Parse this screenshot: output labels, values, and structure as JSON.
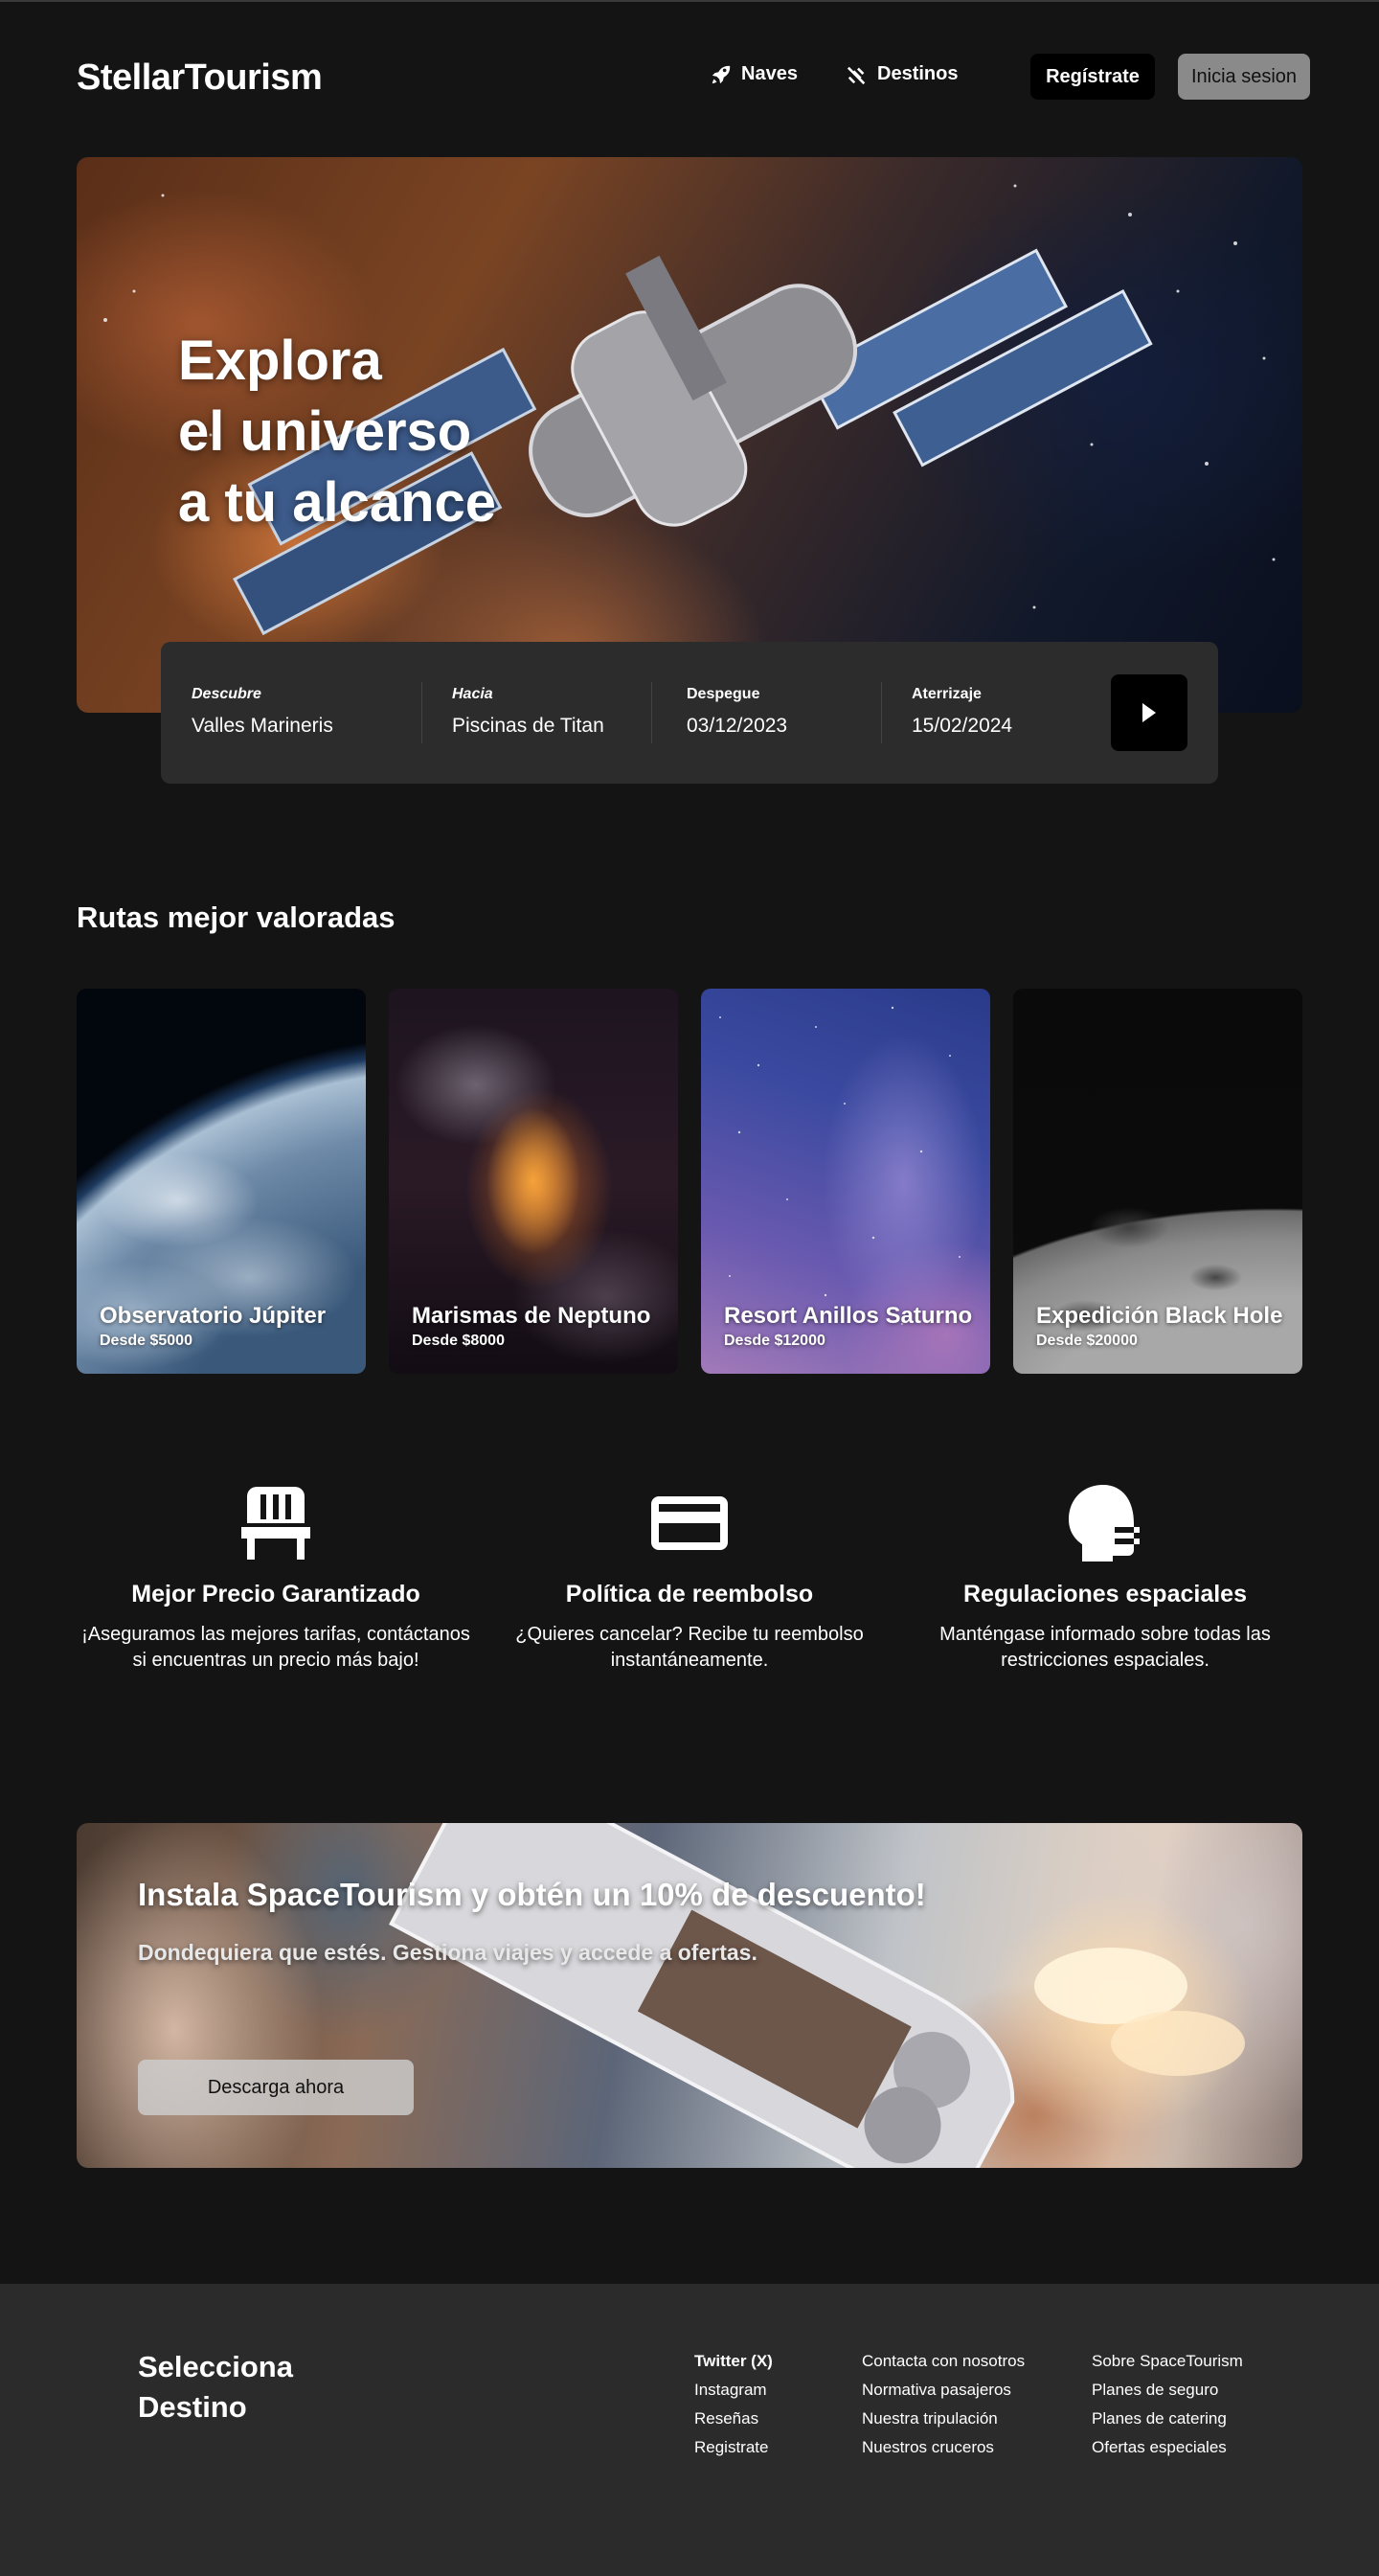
{
  "header": {
    "logo": "StellarTourism",
    "nav": {
      "naves": "Naves",
      "destinos": "Destinos"
    },
    "register_label": "Regístrate",
    "login_label": "Inicia sesion"
  },
  "hero": {
    "title_lines": [
      "Explora",
      "el universo",
      "a tu alcance"
    ]
  },
  "search": {
    "from": {
      "label": "Descubre",
      "value": "Valles Marineris"
    },
    "to": {
      "label": "Hacia",
      "value": "Piscinas de Titan"
    },
    "departure": {
      "label": "Despegue",
      "value": "03/12/2023"
    },
    "landing": {
      "label": "Aterrizaje",
      "value": "15/02/2024"
    }
  },
  "routes": {
    "title": "Rutas mejor valoradas",
    "cards": [
      {
        "name": "Observatorio Júpiter",
        "price": "Desde $5000"
      },
      {
        "name": "Marismas de Neptuno",
        "price": "Desde $8000"
      },
      {
        "name": "Resort Anillos Saturno",
        "price": "Desde $12000"
      },
      {
        "name": "Expedición Black Hole",
        "price": "Desde $20000"
      }
    ]
  },
  "features": [
    {
      "icon": "chair-icon",
      "title": "Mejor Precio Garantizado",
      "desc_lines": [
        "¡Aseguramos las mejores tarifas, contáctanos",
        "si encuentras un precio más bajo!"
      ]
    },
    {
      "icon": "credit-card-icon",
      "title": "Política de reembolso",
      "desc_lines": [
        "¿Quieres cancelar? Recibe tu reembolso",
        "instantáneamente."
      ]
    },
    {
      "icon": "astronaut-helmet-icon",
      "title": "Regulaciones espaciales",
      "desc_lines": [
        "Manténgase informado sobre todas las",
        "restricciones espaciales."
      ]
    }
  ],
  "promo": {
    "title": "Instala SpaceTourism y obtén un 10% de descuento!",
    "subtitle": "Dondequiera que estés. Gestiona viajes y accede a ofertas.",
    "button": "Descarga ahora"
  },
  "footer": {
    "title_lines": [
      "Selecciona",
      "Destino"
    ],
    "col1": [
      "Twitter (X)",
      "Instagram",
      "Reseñas",
      "Registrate"
    ],
    "col2": [
      "Contacta con nosotros",
      "Normativa pasajeros",
      "Nuestra tripulación",
      "Nuestros cruceros"
    ],
    "col3": [
      "Sobre SpaceTourism",
      "Planes de seguro",
      "Planes de catering",
      "Ofertas especiales"
    ]
  },
  "colors": {
    "background": "#141414",
    "search_panel": "#2c2c2c",
    "footer": "#2b2b2b",
    "primary_button": "#000000",
    "secondary_button": "#8a8a8a"
  }
}
